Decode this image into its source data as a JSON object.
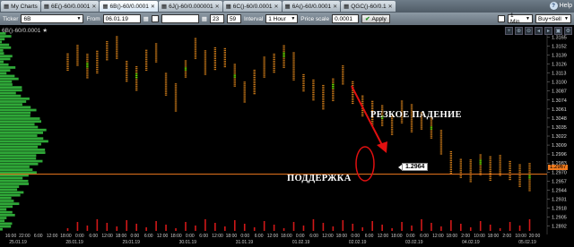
{
  "tabs": [
    {
      "label": "My Charts",
      "active": false
    },
    {
      "label": "6E()-60/0.0001",
      "active": false
    },
    {
      "label": "6B()-60/0.0001",
      "active": true
    },
    {
      "label": "6J()-60/0.000001",
      "active": false
    },
    {
      "label": "6C()-60/0.0001",
      "active": false
    },
    {
      "label": "6A()-60/0.0001",
      "active": false
    },
    {
      "label": "QGC()-60/0.1",
      "active": false
    }
  ],
  "help_label": "Help",
  "toolbar": {
    "ticker_label": "Ticker",
    "ticker_value": "6B",
    "from_label": "From",
    "from_value": "06.01.19",
    "hour_value": "23",
    "minute_value": "59",
    "interval_label": "Interval",
    "interval_value": "1 Hour",
    "price_scale_label": "Price scale",
    "price_scale_value": "0.0001",
    "apply_label": "Apply",
    "period_value": "1 Min",
    "mode_value": "Buy+Sell"
  },
  "chart_title": "6B()-60/0.0001",
  "annotations": {
    "sharp_drop": "РЕЗКОЕ ПАДЕНИЕ",
    "support": "ПОДДЕРЖКА",
    "price_tag": "1.2964",
    "current_price": "1.2967"
  },
  "chart_data": {
    "type": "footprint",
    "y_ticks": [
      "1.3165",
      "1.3152",
      "1.3139",
      "1.3126",
      "1.3113",
      "1.3100",
      "1.3087",
      "1.3074",
      "1.3061",
      "1.3048",
      "1.3035",
      "1.3022",
      "1.3009",
      "1.2996",
      "1.2983",
      "1.2970",
      "1.2957",
      "1.2944",
      "1.2931",
      "1.2918",
      "1.2905",
      "1.2892"
    ],
    "ylim": [
      1.2885,
      1.3172
    ],
    "time_labels": [
      "16:00",
      "22:00",
      "6:00",
      "12:00",
      "18:00",
      "0:00",
      "6:00",
      "12:00",
      "18:00",
      "0:00",
      "6:00",
      "12:00",
      "18:00",
      "0:00",
      "6:00",
      "12:00",
      "18:00",
      "0:00",
      "6:00",
      "12:00",
      "18:00",
      "0:00",
      "6:00",
      "12:00",
      "18:00",
      "0:00",
      "6:00",
      "12:00",
      "18:00",
      "0:00",
      "6:00",
      "12:00",
      "18:00",
      "2:00",
      "10:00",
      "18:00",
      "2:00",
      "10:00",
      "20:00"
    ],
    "date_labels": [
      "25.01.19",
      "28.01.19",
      "29.01.19",
      "30.01.19",
      "31.01.19",
      "01.02.19",
      "02.02.19",
      "03.02.19",
      "04.02.19",
      "05.02.19"
    ],
    "close_series": [
      1.313,
      1.314,
      1.3125,
      1.3135,
      1.3145,
      1.315,
      1.312,
      1.311,
      1.313,
      1.3145,
      1.31,
      1.308,
      1.312,
      1.315,
      1.313,
      1.314,
      1.3135,
      1.311,
      1.309,
      1.3105,
      1.312,
      1.313,
      1.314,
      1.3125,
      1.31,
      1.309,
      1.308,
      1.3095,
      1.311,
      1.3085,
      1.307,
      1.306,
      1.305,
      1.304,
      1.306,
      1.305,
      1.3045,
      1.3035,
      1.3015,
      1.299,
      1.2975,
      1.2972,
      1.2985,
      1.298,
      1.2978,
      1.2975,
      1.2968,
      1.2965
    ],
    "indicator_line": 1.2967
  },
  "colors": {
    "candle": "#c87818",
    "highlight": "#7cfc00",
    "profile": "#2fa838",
    "price_line": "#f07a1e",
    "arrow": "#e01010",
    "volume": "#d01818"
  }
}
